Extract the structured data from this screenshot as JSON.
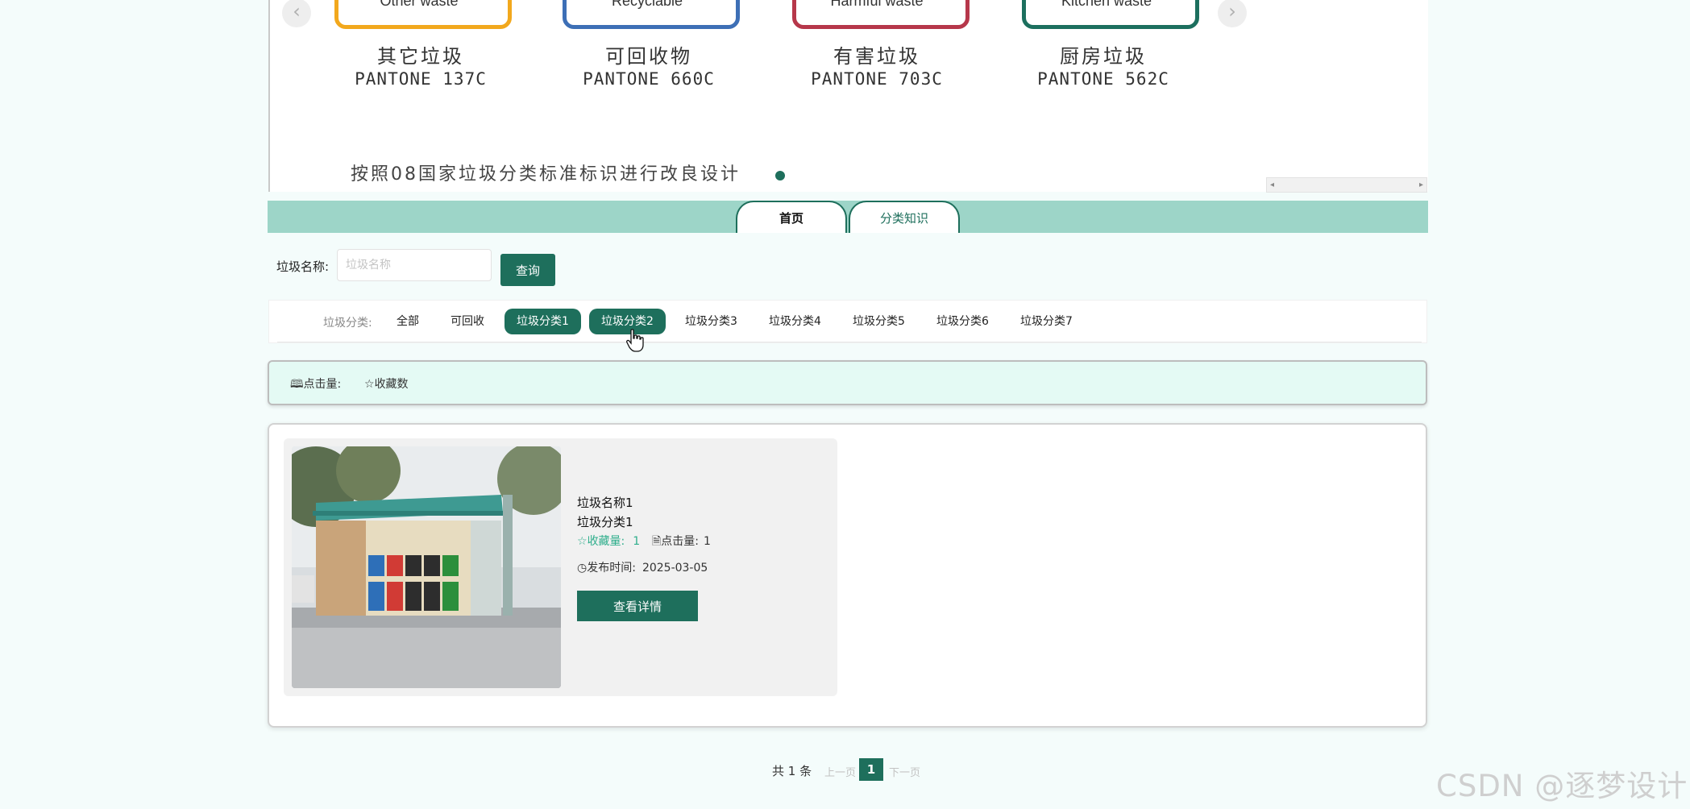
{
  "banner": {
    "bins": [
      {
        "en": "Other waste",
        "cn": "其它垃圾",
        "pantone": "PANTONE 137C",
        "color": "#f2a81d"
      },
      {
        "en": "Recyclable",
        "cn": "可回收物",
        "pantone": "PANTONE 660C",
        "color": "#3d6fb6"
      },
      {
        "en": "Harmful waste",
        "cn": "有害垃圾",
        "pantone": "PANTONE 703C",
        "color": "#b6374a"
      },
      {
        "en": "Kitchen waste",
        "cn": "厨房垃圾",
        "pantone": "PANTONE 562C",
        "color": "#1c6f5e"
      }
    ],
    "caption": "按照08国家垃圾分类标准标识进行改良设计",
    "prev_icon": "chevron-left-icon",
    "next_icon": "chevron-right-icon"
  },
  "nav": {
    "tabs": [
      {
        "label": "首页",
        "active": true
      },
      {
        "label": "分类知识",
        "active": false
      }
    ]
  },
  "search": {
    "label": "垃圾名称:",
    "placeholder": "垃圾名称",
    "value": "",
    "button_label": "查询"
  },
  "filter": {
    "label": "垃圾分类:",
    "items": [
      "全部",
      "可回收",
      "垃圾分类1",
      "垃圾分类2",
      "垃圾分类3",
      "垃圾分类4",
      "垃圾分类5",
      "垃圾分类6",
      "垃圾分类7"
    ],
    "highlighted": [
      "垃圾分类1",
      "垃圾分类2"
    ]
  },
  "sort": {
    "clicks_label": "点击量:",
    "favorites_label": "收藏数"
  },
  "results": [
    {
      "name": "垃圾名称1",
      "category": "垃圾分类1",
      "favorites_label": "收藏量:",
      "favorites": "1",
      "clicks_label": "点击量:",
      "clicks": "1",
      "publish_label": "发布时间:",
      "publish_date": "2025-03-05",
      "detail_label": "查看详情"
    }
  ],
  "pagination": {
    "total": "共 1 条",
    "prev": "上一页",
    "current": "1",
    "next": "下一页"
  },
  "watermark": "CSDN @逐梦设计",
  "colors": {
    "accent": "#1e6f5c",
    "nav_bg": "#9dd5c8",
    "page_bg": "#f4fcfb",
    "stats_bg": "#e4faf4"
  }
}
